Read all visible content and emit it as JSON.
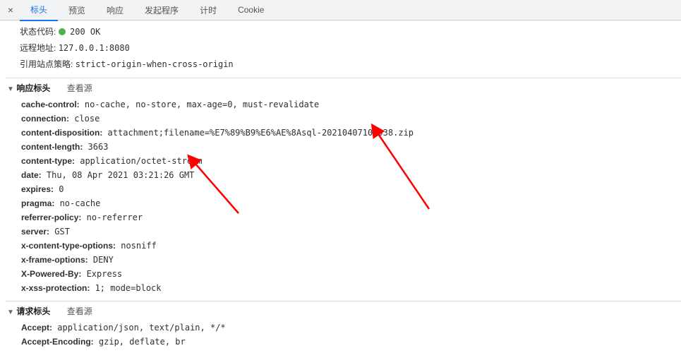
{
  "tabs": {
    "close": "×",
    "headers": "标头",
    "preview": "预览",
    "response": "响应",
    "initiator": "发起程序",
    "timing": "计时",
    "cookies": "Cookie"
  },
  "general": {
    "status_label": "状态代码:",
    "status_value": "200 OK",
    "remote_label": "远程地址:",
    "remote_value": "127.0.0.1:8080",
    "referrer_label": "引用站点策略:",
    "referrer_value": "strict-origin-when-cross-origin"
  },
  "section_labels": {
    "response_headers": "响应标头",
    "request_headers": "请求标头",
    "view_source": "查看源"
  },
  "response_headers": [
    {
      "key": "cache-control:",
      "value": "no-cache, no-store, max-age=0, must-revalidate"
    },
    {
      "key": "connection:",
      "value": "close"
    },
    {
      "key": "content-disposition:",
      "value": "attachment;filename=%E7%89%B9%E6%AE%8Asql-20210407101938.zip"
    },
    {
      "key": "content-length:",
      "value": "3663"
    },
    {
      "key": "content-type:",
      "value": "application/octet-stream"
    },
    {
      "key": "date:",
      "value": "Thu, 08 Apr 2021 03:21:26 GMT"
    },
    {
      "key": "expires:",
      "value": "0"
    },
    {
      "key": "pragma:",
      "value": "no-cache"
    },
    {
      "key": "referrer-policy:",
      "value": "no-referrer"
    },
    {
      "key": "server:",
      "value": "GST"
    },
    {
      "key": "x-content-type-options:",
      "value": "nosniff"
    },
    {
      "key": "x-frame-options:",
      "value": "DENY"
    },
    {
      "key": "X-Powered-By:",
      "value": "Express"
    },
    {
      "key": "x-xss-protection:",
      "value": "1; mode=block"
    }
  ],
  "request_headers": [
    {
      "key": "Accept:",
      "value": "application/json, text/plain, */*"
    },
    {
      "key": "Accept-Encoding:",
      "value": "gzip, deflate, br"
    }
  ]
}
